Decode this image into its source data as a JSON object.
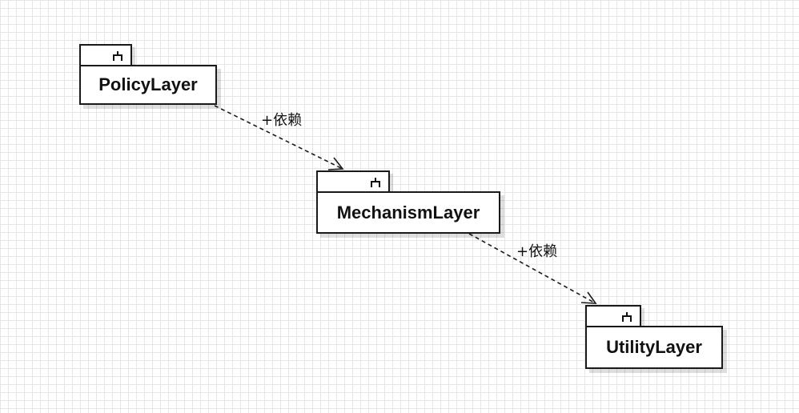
{
  "diagram": {
    "packages": [
      {
        "id": "policy",
        "name": "PolicyLayer",
        "icon": "fork-icon"
      },
      {
        "id": "mechanism",
        "name": "MechanismLayer",
        "icon": "fork-icon"
      },
      {
        "id": "utility",
        "name": "UtilityLayer",
        "icon": "fork-icon"
      }
    ],
    "dependencies": [
      {
        "from": "policy",
        "to": "mechanism",
        "label": "+依赖",
        "style": "dashed",
        "arrow": "open"
      },
      {
        "from": "mechanism",
        "to": "utility",
        "label": "+依赖",
        "style": "dashed",
        "arrow": "open"
      }
    ]
  }
}
